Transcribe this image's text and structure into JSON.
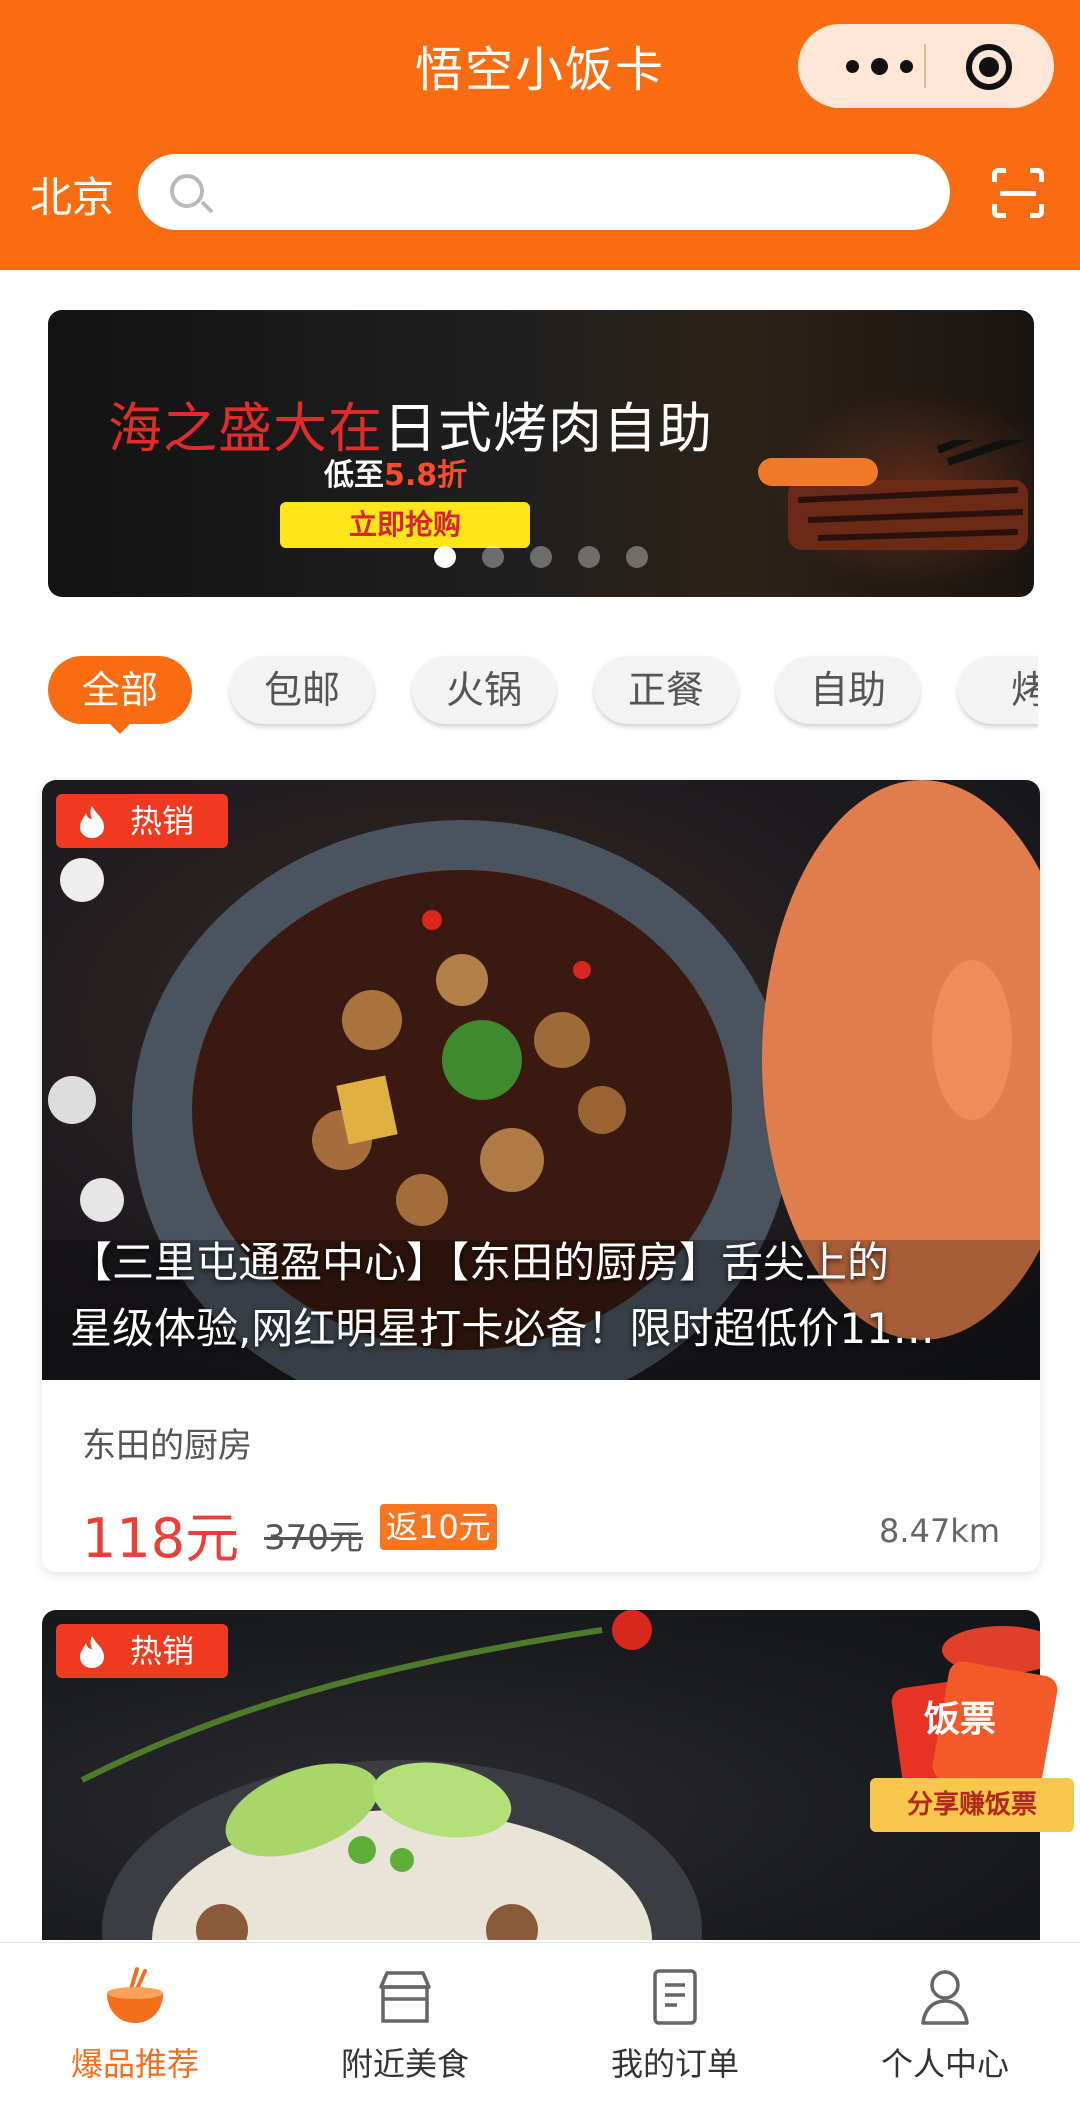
{
  "header": {
    "title": "悟空小饭卡",
    "city": "北京",
    "search_placeholder": ""
  },
  "banner": {
    "title_red": "海之盛大在",
    "title_white": "日式烤肉自助",
    "subtitle_prefix": "低至",
    "subtitle_rate": "5.8折",
    "button": "立即抢购",
    "slide_count": 5,
    "active_slide": 1
  },
  "categories": [
    "全部",
    "包邮",
    "火锅",
    "正餐",
    "自助",
    "烤"
  ],
  "products": [
    {
      "badge": "热销",
      "title_line1": "【三里屯通盈中心】【东田的厨房】舌尖上的",
      "title_line2": "星级体验,网红明星打卡必备！限时超低价11…",
      "shop": "东田的厨房",
      "price": "118元",
      "original_price": "370元",
      "rebate": "返10元",
      "distance": "8.47km"
    },
    {
      "badge": "热销"
    }
  ],
  "share": {
    "icon_text": "饭票",
    "label": "分享赚饭票"
  },
  "bottom_nav": [
    {
      "label": "爆品推荐",
      "icon": "rice-bowl-icon",
      "active": true
    },
    {
      "label": "附近美食",
      "icon": "shop-icon",
      "active": false
    },
    {
      "label": "我的订单",
      "icon": "order-icon",
      "active": false
    },
    {
      "label": "个人中心",
      "icon": "user-icon",
      "active": false
    }
  ],
  "colors": {
    "brand_orange": "#fa6c12",
    "price_red": "#e8403a",
    "hot_badge_red": "#ef3a1f"
  }
}
